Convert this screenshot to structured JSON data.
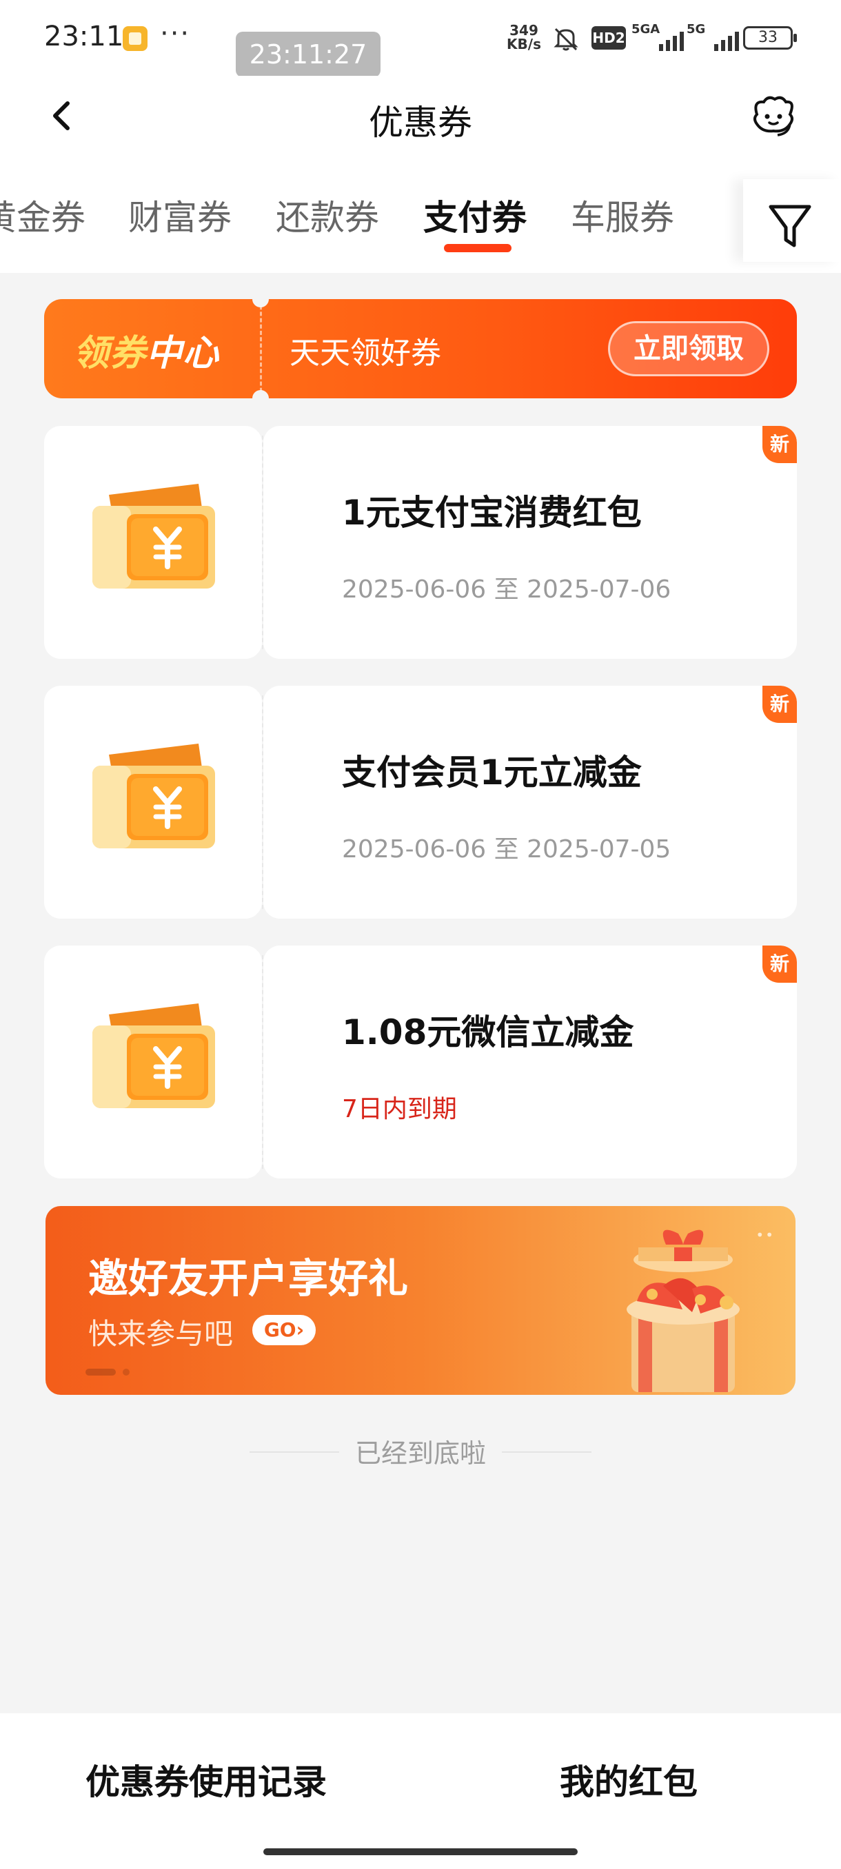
{
  "status_bar": {
    "time": "23:11",
    "dots": "···",
    "clock_overlay": "23:11:27",
    "net_speed_value": "349",
    "net_speed_unit": "KB/s",
    "hd_label": "HD2",
    "signal1_label": "5GA",
    "signal2_label": "5G",
    "battery": "33"
  },
  "nav": {
    "title": "优惠券",
    "back_icon": "chevron-left-icon",
    "service_icon": "customer-service-icon"
  },
  "tabs": [
    {
      "label": "黄金券",
      "active": false
    },
    {
      "label": "财富券",
      "active": false
    },
    {
      "label": "还款券",
      "active": false
    },
    {
      "label": "支付券",
      "active": true
    },
    {
      "label": "车服券",
      "active": false
    }
  ],
  "filter_icon": "filter-icon",
  "banner": {
    "part1": "领券",
    "part2": "中心",
    "text": "天天领好券",
    "button": "立即领取"
  },
  "coupons": [
    {
      "title": "1元支付宝消费红包",
      "date": "2025-06-06 至 2025-07-06",
      "badge": "新",
      "warn": false
    },
    {
      "title": "支付会员1元立减金",
      "date": "2025-06-06 至 2025-07-05",
      "badge": "新",
      "warn": false
    },
    {
      "title": "1.08元微信立减金",
      "date": "7日内到期",
      "badge": "新",
      "warn": true
    }
  ],
  "invite": {
    "title": "邀好友开户享好礼",
    "subtitle": "快来参与吧",
    "go": "GO›"
  },
  "end_text": "已经到底啦",
  "bottom": {
    "left": "优惠券使用记录",
    "right": "我的红包"
  },
  "colors": {
    "accent": "#ff3d13",
    "banner_start": "#ff7a1c",
    "banner_end": "#ff3d0a",
    "warn": "#d8251a"
  }
}
